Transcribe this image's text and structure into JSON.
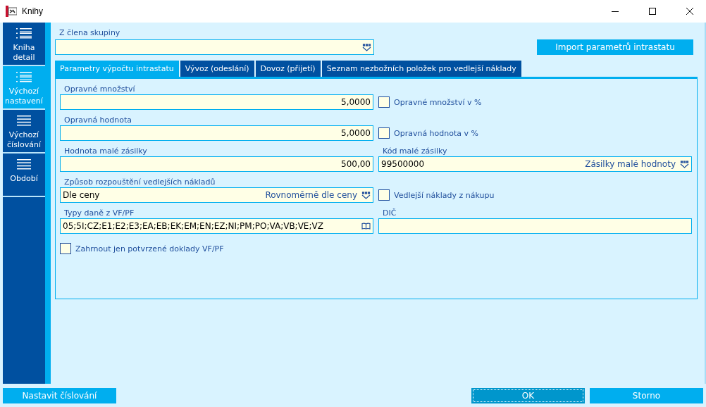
{
  "window": {
    "title": "Knihy"
  },
  "sidebar": {
    "items": [
      {
        "label": "Kniha detail",
        "kind": "bulleted",
        "selected": false
      },
      {
        "label": "Výchozí nastavení",
        "kind": "bulleted",
        "selected": true
      },
      {
        "label": "Výchozí číslování",
        "kind": "lines",
        "selected": false
      },
      {
        "label": "Období",
        "kind": "lines",
        "selected": false
      }
    ]
  },
  "group_member": {
    "label": "Z člena skupiny"
  },
  "import_button": "Import parametrů intrastatu",
  "tabs": [
    {
      "label": "Parametry výpočtu intrastatu",
      "selected": true
    },
    {
      "label": "Vývoz (odeslání)",
      "selected": false
    },
    {
      "label": "Dovoz (přijetí)",
      "selected": false
    },
    {
      "label": "Seznam nezbožních položek pro vedlejší náklady",
      "selected": false
    }
  ],
  "form": {
    "rows": [
      [
        {
          "kind": "number",
          "label": "Opravné množství",
          "value": "5,0000"
        },
        {
          "kind": "checkbox",
          "label": "Opravné množství v %",
          "checked": false
        }
      ],
      [
        {
          "kind": "number",
          "label": "Opravná hodnota",
          "value": "5,0000"
        },
        {
          "kind": "checkbox",
          "label": "Opravná hodnota v %",
          "checked": false
        }
      ],
      [
        {
          "kind": "number",
          "label": "Hodnota malé zásilky",
          "value": "500,00"
        },
        {
          "kind": "lookup",
          "label": "Kód malé zásilky",
          "value": "99500000",
          "description": "Zásilky malé hodnoty"
        }
      ],
      [
        {
          "kind": "lookup",
          "label": "Způsob rozpouštění vedlejších nákladů",
          "value": "Dle ceny",
          "description": "Rovnoměrně dle ceny"
        },
        {
          "kind": "checkbox",
          "label": "Vedlejší náklady z nákupu",
          "checked": false
        }
      ],
      [
        {
          "kind": "picker",
          "label": "Typy daně z VF/PF",
          "value": "05;5I;CZ;E1;E2;E3;EA;EB;EK;EM;EN;EZ;NI;PM;PO;VA;VB;VE;VZ"
        },
        {
          "kind": "text",
          "label": "DIČ"
        }
      ],
      [
        {
          "kind": "checkbox",
          "label": "Zahrnout jen potvrzené doklady VF/PF",
          "checked": false
        }
      ]
    ]
  },
  "buttons": [
    {
      "label": "Nastavit číslování",
      "focused": false
    },
    {
      "label": "OK",
      "focused": true
    },
    {
      "label": "Storno",
      "focused": false
    }
  ]
}
